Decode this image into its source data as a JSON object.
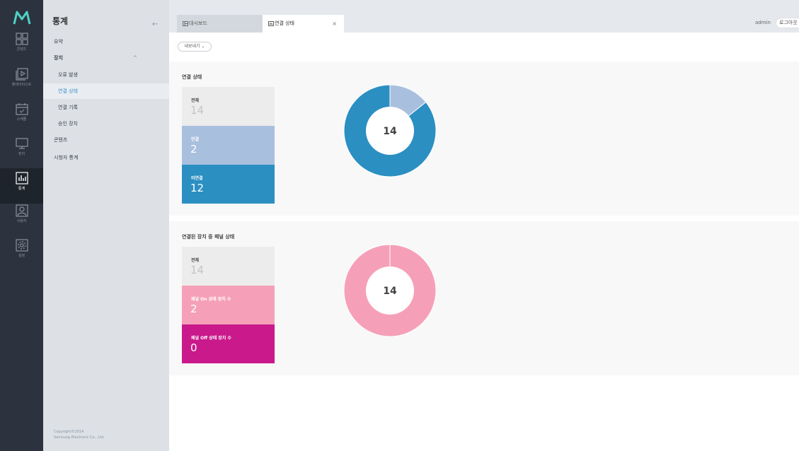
{
  "sidebar": {
    "items": [
      {
        "icon": "grid-icon",
        "label": "콘텐츠"
      },
      {
        "icon": "playlist-icon",
        "label": "플레이리스트"
      },
      {
        "icon": "calendar-icon",
        "label": "스케줄"
      },
      {
        "icon": "monitor-icon",
        "label": "장치"
      },
      {
        "icon": "chart-icon",
        "label": "통계"
      },
      {
        "icon": "user-icon",
        "label": "사용자"
      },
      {
        "icon": "gear-icon",
        "label": "설정"
      }
    ],
    "active": "통계"
  },
  "menu": {
    "title": "통계",
    "collapse_icon": "←",
    "items": [
      {
        "label": "요약"
      },
      {
        "label": "장치"
      },
      {
        "label": "오류 발생"
      },
      {
        "label": "연결 상태"
      },
      {
        "label": "연결 기록"
      },
      {
        "label": "승인 장치"
      },
      {
        "label": "콘텐츠"
      },
      {
        "label": "시청자 통계"
      }
    ],
    "expand_caret": "^",
    "copyright_line1": "Copyright©2014",
    "copyright_line2": "Samsung Electronic Co., Ltd."
  },
  "header": {
    "tabs": [
      {
        "label": "대시보드"
      },
      {
        "label": "연결 상태",
        "close": "×"
      }
    ],
    "user": "admin",
    "logout_label": "로그아웃"
  },
  "toolbar": {
    "export_label": "내보내기 ⌄"
  },
  "connection_status": {
    "title": "연결 상태",
    "total_label": "전체",
    "total_value": "14",
    "connected_label": "연결",
    "connected_value": "2",
    "disconnected_label": "미연결",
    "disconnected_value": "12",
    "center_value": "14",
    "colors": {
      "connected": "#a9bfde",
      "disconnected": "#2b8fc2"
    }
  },
  "panel_status": {
    "title": "연결된 장치 중 패널 상태",
    "total_label": "전체",
    "total_value": "14",
    "on_label": "패널 On 상태 장치 수",
    "on_value": "2",
    "off_label": "패널 Off 상태 장치 수",
    "off_value": "0",
    "center_value": "14",
    "colors": {
      "on": "#f5a0b8",
      "off": "#c9198b"
    }
  },
  "chart_data": [
    {
      "type": "pie",
      "categories": [
        "연결",
        "미연결"
      ],
      "values": [
        2,
        12
      ],
      "center_label": "14"
    },
    {
      "type": "pie",
      "categories": [
        "패널 On 상태 장치 수",
        "패널 Off 상태 장치 수"
      ],
      "values": [
        14,
        0
      ],
      "center_label": "14"
    }
  ]
}
